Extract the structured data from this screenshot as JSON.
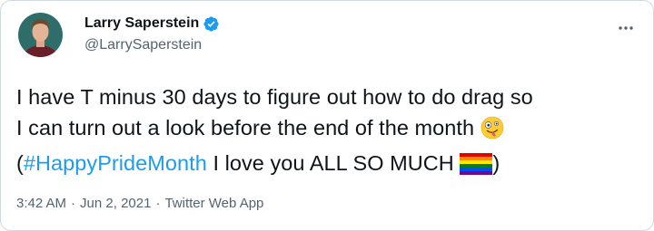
{
  "user": {
    "display_name": "Larry Saperstein",
    "handle": "@LarrySaperstein",
    "verified": true
  },
  "tweet": {
    "line1": "I have T minus 30 days to figure out how to do drag so",
    "line2": "I can turn out a look before the end of the month",
    "line2_emoji": "zany-face-emoji",
    "open_paren": "(",
    "hashtag": "#HappyPrideMonth",
    "line3_rest": " I love you ALL SO MUCH ",
    "line3_emoji": "rainbow-flag-emoji",
    "close_paren": ")"
  },
  "meta": {
    "time": "3:42 AM",
    "separator1": "·",
    "date": "Jun 2, 2021",
    "separator2": "·",
    "source": "Twitter Web App"
  },
  "colors": {
    "link": "#1d9bf0",
    "secondary_text": "#536471",
    "border": "#cfd9de"
  },
  "icons": {
    "more": "more-horizontal-icon",
    "verified": "verified-badge-icon"
  }
}
